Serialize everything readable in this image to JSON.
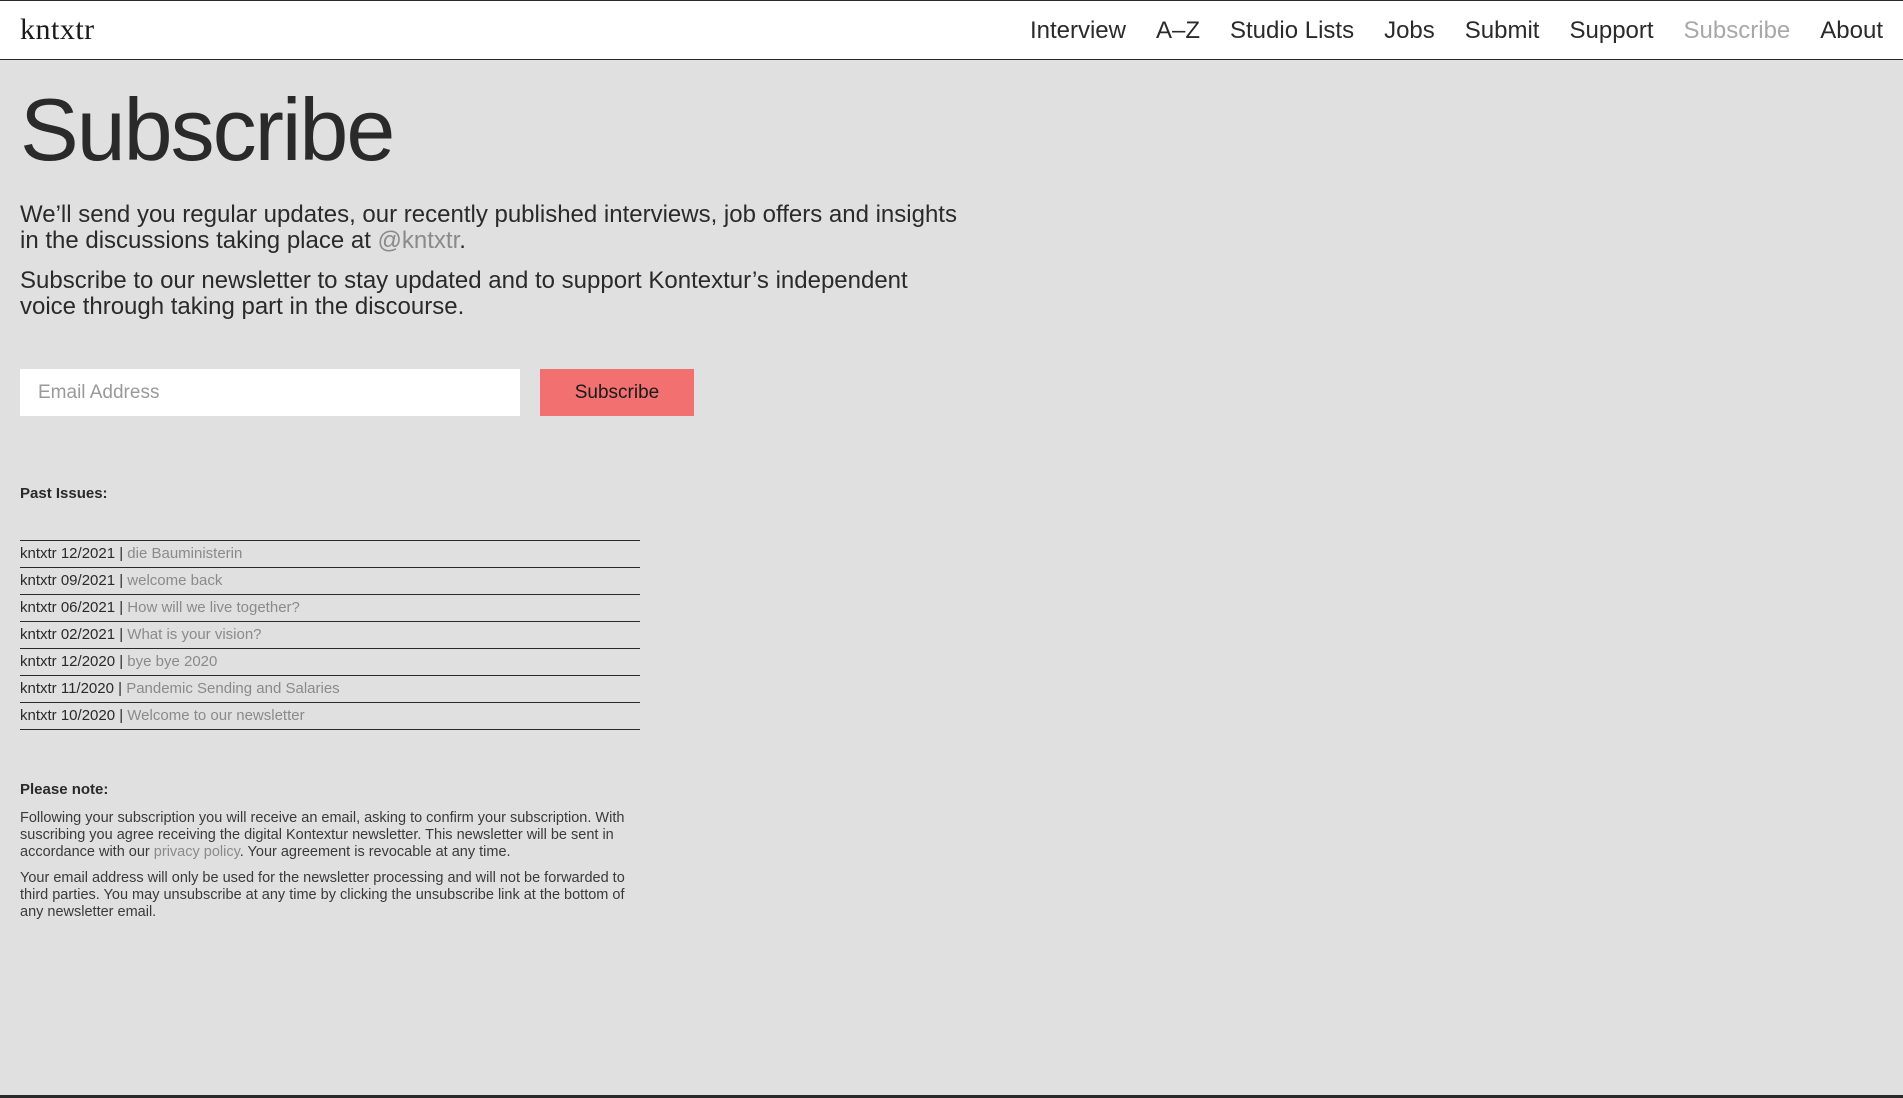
{
  "header": {
    "logo": "kntxtr",
    "nav": [
      {
        "label": "Interview",
        "active": false
      },
      {
        "label": "A–Z",
        "active": false
      },
      {
        "label": "Studio Lists",
        "active": false
      },
      {
        "label": "Jobs",
        "active": false
      },
      {
        "label": "Submit",
        "active": false
      },
      {
        "label": "Support",
        "active": false
      },
      {
        "label": "Subscribe",
        "active": true
      },
      {
        "label": "About",
        "active": false
      }
    ]
  },
  "main": {
    "title": "Subscribe",
    "intro1_text": "We’ll send you regular updates, our recently published interviews, job offers and insights in the discussions taking place at ",
    "intro1_handle": "@kntxtr",
    "intro1_end": ".",
    "intro2": "Subscribe to our newsletter to stay updated and to support Kontextur’s independent voice through taking part in the discourse."
  },
  "form": {
    "email_placeholder": "Email Address",
    "email_value": "",
    "button_label": "Subscribe"
  },
  "past_issues": {
    "label": "Past Issues:",
    "items": [
      {
        "id": "kntxtr 12/2021",
        "title": "die Bauministerin"
      },
      {
        "id": "kntxtr 09/2021",
        "title": "welcome back"
      },
      {
        "id": "kntxtr 06/2021",
        "title": "How will we live together?"
      },
      {
        "id": "kntxtr 02/2021",
        "title": "What is your vision?"
      },
      {
        "id": "kntxtr 12/2020",
        "title": "bye bye 2020"
      },
      {
        "id": "kntxtr 11/2020",
        "title": "Pandemic Sending and Salaries"
      },
      {
        "id": "kntxtr 10/2020",
        "title": "Welcome to our newsletter"
      }
    ]
  },
  "note": {
    "label": "Please note:",
    "p1_before": "Following your subscription you will receive an email, asking to confirm your subscription. With suscribing you agree receiving the digital Kontextur newsletter. This newsletter will be sent in accordance with our ",
    "p1_link": "privacy policy",
    "p1_after": ". Your agreement is revocable at any time.",
    "p2": "Your email address will only be used for the newsletter processing and will not be forwarded to third parties. You may unsubscribe at any time by clicking the unsubscribe link at the bottom of any newsletter email."
  },
  "colors": {
    "background": "#e0e0e0",
    "accent_button": "#f27070",
    "muted_text": "#8a8a8a",
    "active_nav": "#a8a8a8"
  }
}
